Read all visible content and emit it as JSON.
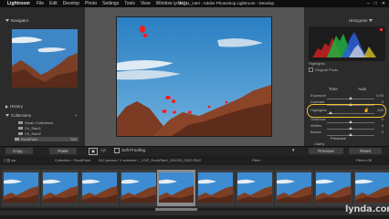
{
  "menubar": {
    "app": "Lightroom",
    "items": [
      "File",
      "Edit",
      "Develop",
      "Photo",
      "Settings",
      "Tools",
      "View",
      "Window",
      "Help"
    ],
    "window_title": "lynda_11_intel - Adobe Photoshop Lightroom - Develop"
  },
  "left_panel": {
    "navigator_label": "Navigator",
    "history_label": "History",
    "collections_label": "Collections",
    "collections": [
      "Smart Collections",
      "Ch_Start1",
      "Ch_Start2",
      "RockPaint"
    ],
    "collections_counts": [
      "",
      "",
      "",
      "342"
    ],
    "copy_label": "Copy...",
    "paste_label": "Paste"
  },
  "right_panel": {
    "histogram_label": "Histogram",
    "original_photo_label": "Original Photo",
    "highlights_label": "Highlights",
    "tone_label": "Tone",
    "auto_label": "Auto",
    "sliders": [
      {
        "label": "Exposure",
        "value": "0.00"
      },
      {
        "label": "Contrast",
        "value": "0"
      },
      {
        "label": "Highlights",
        "value": "-100"
      },
      {
        "label": "Shadows",
        "value": "0"
      },
      {
        "label": "Whites",
        "value": "0"
      },
      {
        "label": "Blacks",
        "value": "0"
      }
    ],
    "presence_label": "Presence",
    "clarity_label": "Clarity",
    "previous_label": "Previous",
    "reset_label": "Reset"
  },
  "toolbar": {
    "soft_proofing_label": "Soft Proofing"
  },
  "filmstrip_bar": {
    "collection_text": "Collection : RockPaint",
    "count_text": "342 photos / 1 selected / _VOF_RockPaint_191025_0202.RW2",
    "filename_text": "_VOF_RockPaint_191025_0282.RW2",
    "filter_label": "Filter :",
    "filter_value": "Filters Off"
  },
  "watermark": "lynda.com",
  "colors": {
    "highlight_ring": "#f2c22a",
    "clipping": "#ff1a1a"
  }
}
